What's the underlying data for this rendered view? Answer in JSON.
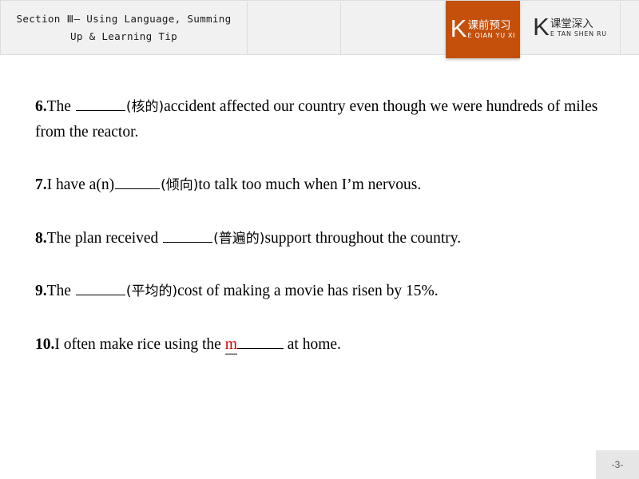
{
  "header": {
    "section_title": "Section Ⅲ— Using Language, Summing\nUp & Learning Tip",
    "tabs": [
      {
        "id": "ke-qian-yu-xi",
        "initial": "K",
        "chinese": "课前预习",
        "pinyin": "E QIAN YU XI",
        "active": true,
        "bg_color": "#c4500c",
        "text_color": "#ffffff"
      },
      {
        "id": "ke-tang-shen-ru",
        "initial": "K",
        "chinese": "课堂深入",
        "pinyin": "E TAN SHEN RU",
        "active": false,
        "bg_color": "#f1f1f1",
        "text_color": "#2b2b2b"
      }
    ],
    "bg_color": "#f1f1f1",
    "divider_color": "#dcdcdc"
  },
  "content": {
    "questions": [
      {
        "number": "6.",
        "pre": "The",
        "hint": "(核的)",
        "post": "accident affected our country even though we were hundreds of miles from the reactor.",
        "blank_style": "plain"
      },
      {
        "number": "7.",
        "pre": "I have a(n)",
        "hint": "(倾向)",
        "post": "to talk too much when I’m nervous.",
        "blank_style": "plain"
      },
      {
        "number": "8.",
        "pre": "The plan received",
        "hint": "(普遍的)",
        "post": "support throughout the country.",
        "blank_style": "plain"
      },
      {
        "number": "9.",
        "pre": "The",
        "hint": "(平均的)",
        "post": "cost of making a movie has risen by 15%.",
        "blank_style": "plain"
      },
      {
        "number": "10.",
        "pre": "I often make rice using the",
        "seed_letter": "m",
        "hint": "",
        "post": "at home.",
        "blank_style": "seeded",
        "seed_color": "#cc0000"
      }
    ]
  },
  "footer": {
    "page_number": "-3-",
    "bg_color": "#e6e6e6"
  }
}
